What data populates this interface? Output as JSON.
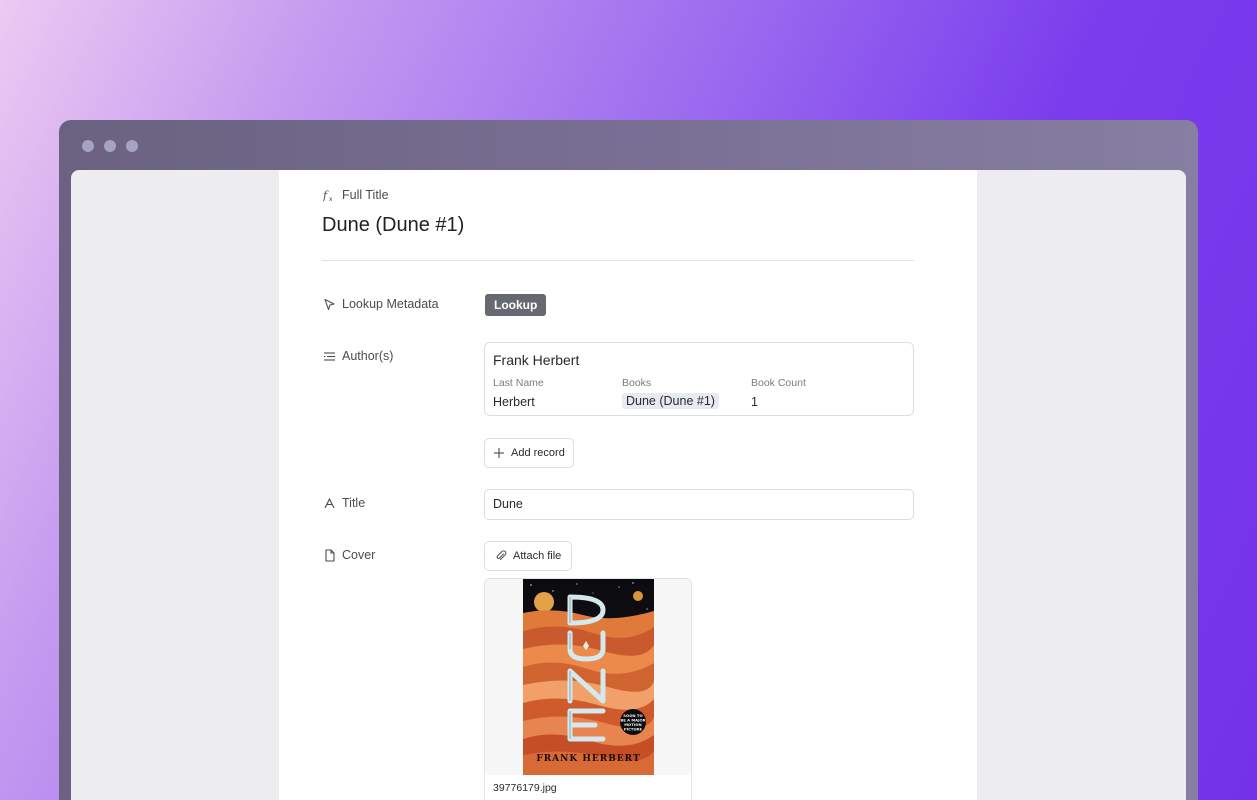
{
  "fields": {
    "full_title": {
      "label": "Full Title",
      "value": "Dune (Dune #1)",
      "icon": "formula-icon"
    },
    "lookup": {
      "label": "Lookup Metadata",
      "button": "Lookup",
      "icon": "cursor-icon"
    },
    "authors": {
      "label": "Author(s)",
      "icon": "list-icon",
      "record": {
        "name": "Frank Herbert",
        "columns": [
          {
            "header": "Last Name",
            "value": "Herbert"
          },
          {
            "header": "Books",
            "value": "Dune (Dune #1)"
          },
          {
            "header": "Book Count",
            "value": "1"
          }
        ]
      },
      "add_button": "Add record"
    },
    "title": {
      "label": "Title",
      "value": "Dune",
      "icon": "text-icon"
    },
    "cover": {
      "label": "Cover",
      "icon": "file-icon",
      "attach_button": "Attach file",
      "filename": "39776179.jpg",
      "image_text": {
        "title": "DUNE",
        "author": "FRANK HERBERT",
        "badge": "SOON TO BE A MAJOR MOTION PICTURE"
      }
    }
  },
  "colors": {
    "accent_button": "#676970",
    "background_start": "#eccaf2",
    "background_end": "#7432e8"
  }
}
